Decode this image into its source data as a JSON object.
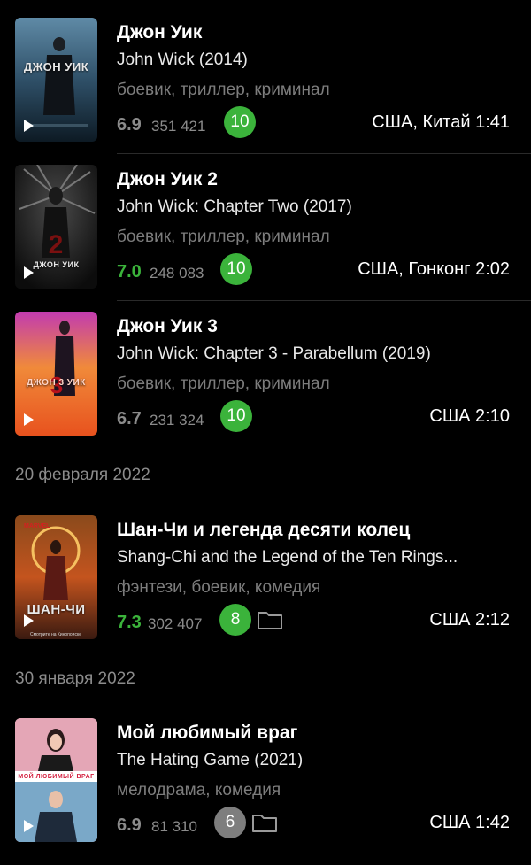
{
  "movies": [
    {
      "title": "Джон Уик",
      "original": "John Wick (2014)",
      "genres": "боевик, триллер, криминал",
      "rating": "6.9",
      "votes": "351 421",
      "my_rating": "10",
      "meta": "США, Китай 1:41",
      "poster_text": "ДЖОН УИК"
    },
    {
      "title": "Джон Уик 2",
      "original": "John Wick: Chapter Two (2017)",
      "genres": "боевик, триллер, криминал",
      "rating": "7.0",
      "votes": "248 083",
      "my_rating": "10",
      "meta": "США, Гонконг 2:02",
      "poster_text": "ДЖОН УИК"
    },
    {
      "title": "Джон Уик 3",
      "original": "John Wick: Chapter 3 - Parabellum (2019)",
      "genres": "боевик, триллер, криминал",
      "rating": "6.7",
      "votes": "231 324",
      "my_rating": "10",
      "meta": "США 2:10",
      "poster_text": "ДЖОН 3 УИК"
    },
    {
      "title": "Шан-Чи и легенда десяти колец",
      "original": "Shang-Chi and the Legend of the Ten Rings...",
      "genres": "фэнтези, боевик, комедия",
      "rating": "7.3",
      "votes": "302 407",
      "my_rating": "8",
      "meta": "США 2:12",
      "poster_text": "ШАН-ЧИ"
    },
    {
      "title": "Мой любимый враг",
      "original": "The Hating Game (2021)",
      "genres": "мелодрама, комедия",
      "rating": "6.9",
      "votes": "81 310",
      "my_rating": "6",
      "meta": "США 1:42",
      "poster_text": "МОЙ ЛЮБИМЫЙ ВРАГ"
    }
  ],
  "dates": [
    "20 февраля 2022",
    "30 января 2022"
  ],
  "colors": {
    "green": "#3bb33b",
    "gray_badge": "#7e7e7e",
    "muted": "#8b8b8b"
  },
  "icons": {
    "play": "play-icon",
    "folder": "folder-icon"
  }
}
